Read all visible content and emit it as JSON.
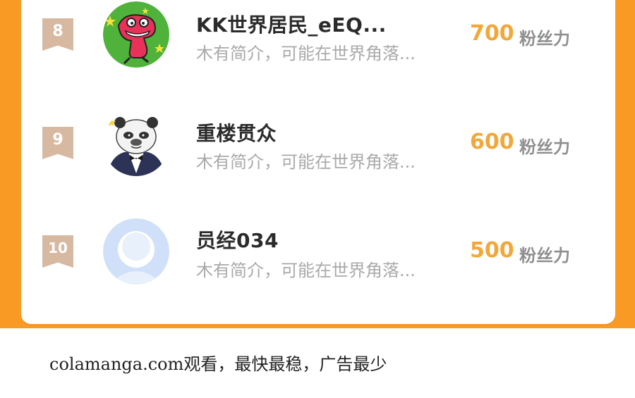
{
  "leaderboard": {
    "rows": [
      {
        "rank": "8",
        "name": "KK世界居民_eEQ...",
        "bio": "木有简介，可能在世界角落...",
        "fans": "700",
        "fans_unit": "粉丝力",
        "avatar": "crayon-shin-chan-dinosaur-avatar"
      },
      {
        "rank": "9",
        "name": "重楼贯众",
        "bio": "木有简介，可能在世界角落...",
        "fans": "600",
        "fans_unit": "粉丝力",
        "avatar": "panda-tuxedo-avatar"
      },
      {
        "rank": "10",
        "name": "员经034",
        "bio": "木有简介，可能在世界角落...",
        "fans": "500",
        "fans_unit": "粉丝力",
        "avatar": "default-user-avatar"
      }
    ]
  },
  "footer": {
    "watermark": "colamanga.com观看，最快最稳，广告最少"
  },
  "colors": {
    "accent": "#f99a24",
    "fans_number": "#f2a73a",
    "badge": "#d7b9a2",
    "avatar_default": "#cfe0f8"
  }
}
